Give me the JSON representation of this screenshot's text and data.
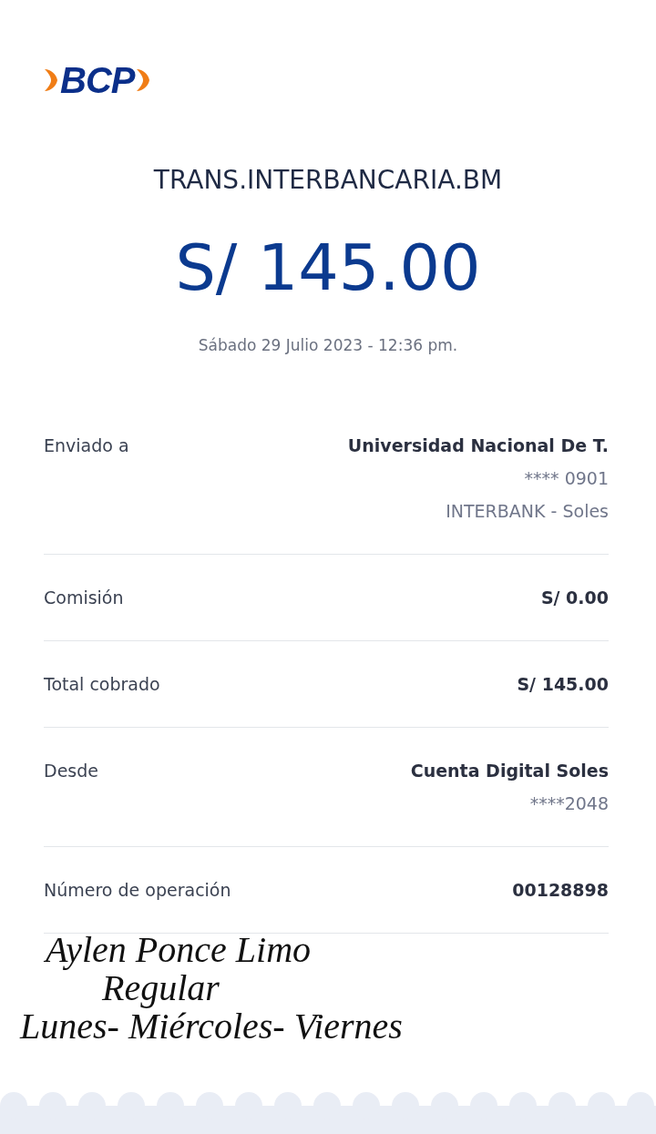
{
  "logo": {
    "text": "BCP"
  },
  "title": "TRANS.INTERBANCARIA.BM",
  "amount": "S/ 145.00",
  "date": "Sábado 29 Julio 2023 - 12:36 pm.",
  "details": [
    {
      "label": "Enviado a",
      "values": [
        {
          "text": "Universidad Nacional De T.",
          "bold": true
        },
        {
          "text": "**** 0901",
          "bold": false
        },
        {
          "text": "INTERBANK - Soles",
          "bold": false
        }
      ]
    },
    {
      "label": "Comisión",
      "values": [
        {
          "text": "S/ 0.00",
          "bold": true
        }
      ]
    },
    {
      "label": "Total cobrado",
      "values": [
        {
          "text": "S/ 145.00",
          "bold": true
        }
      ]
    },
    {
      "label": "Desde",
      "values": [
        {
          "text": "Cuenta Digital Soles",
          "bold": true
        },
        {
          "text": "****2048",
          "bold": false
        }
      ]
    },
    {
      "label": "Número de operación",
      "values": [
        {
          "text": "00128898",
          "bold": true
        }
      ]
    }
  ],
  "handwritten_note": [
    "Aylen Ponce Limo",
    "Regular",
    "Lunes- Miércoles- Viernes"
  ]
}
